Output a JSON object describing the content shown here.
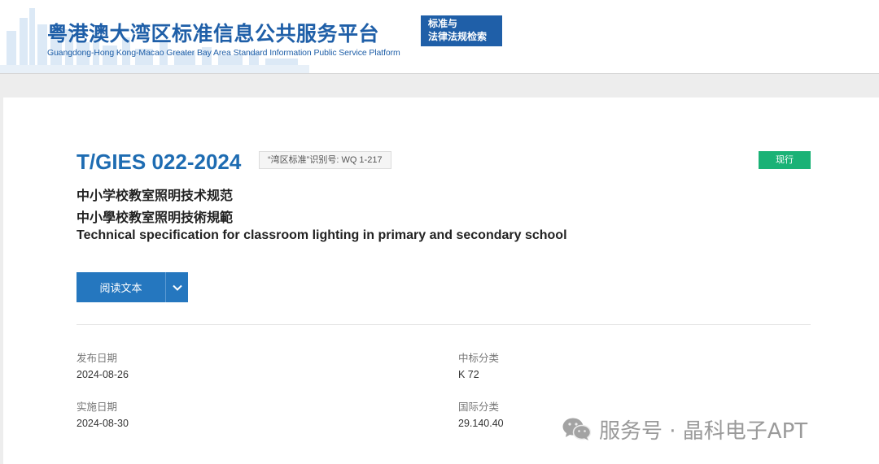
{
  "header": {
    "title": "粤港澳大湾区标准信息公共服务平台",
    "subtitle": "Guangdong-Hong Kong-Macao Greater Bay Area Standard Information Public Service Platform",
    "badge_line1": "标准与",
    "badge_line2": "法律法规检索",
    "brand_color": "#1f5fa8"
  },
  "standard": {
    "code": "T/GIES 022-2024",
    "wq_tag": "“湾区标准”识别号: WQ 1-217",
    "status": "现行",
    "status_color": "#1ab276",
    "title_cn": "中小学校教室照明技术规范",
    "title_hk": "中小學校教室照明技術規範",
    "title_en": "Technical specification for classroom lighting in primary and secondary school"
  },
  "actions": {
    "read_label": "阅读文本",
    "dropdown_icon": "chevron-down-icon"
  },
  "meta": {
    "publish_date_label": "发布日期",
    "publish_date": "2024-08-26",
    "ccs_label": "中标分类",
    "ccs": "K 72",
    "effective_date_label": "实施日期",
    "effective_date": "2024-08-30",
    "ics_label": "国际分类",
    "ics": "29.140.40"
  },
  "watermark": {
    "text": "服务号 · 晶科电子APT",
    "icon": "wechat-icon"
  }
}
